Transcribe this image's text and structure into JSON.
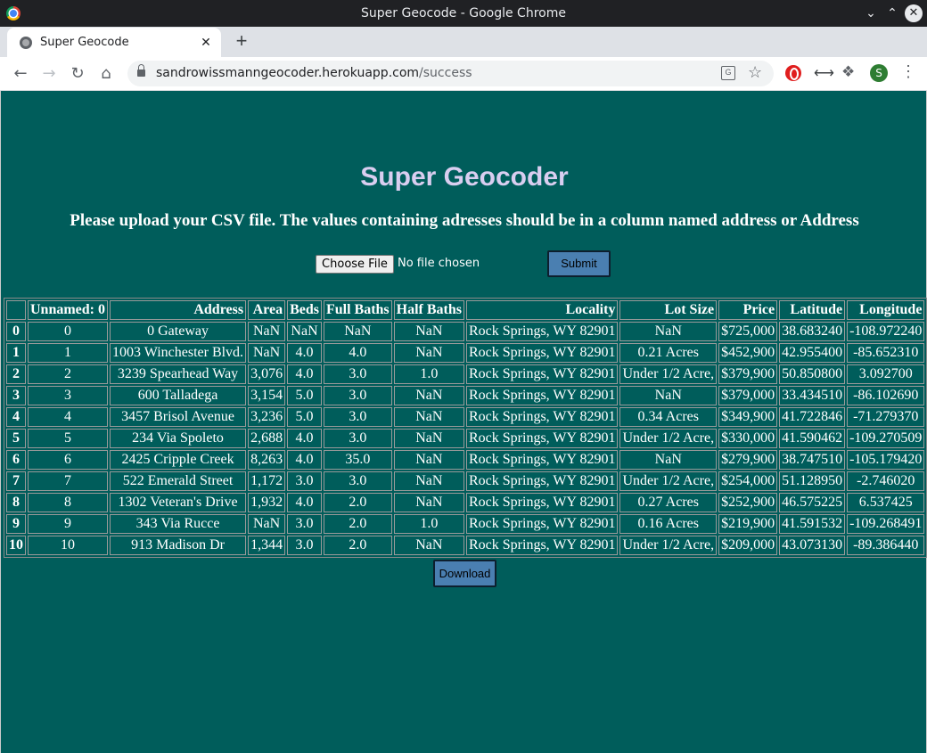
{
  "window": {
    "title": "Super Geocode - Google Chrome"
  },
  "tab": {
    "title": "Super Geocode"
  },
  "address_bar": {
    "host": "sandrowissmanngeocoder.herokuapp.com",
    "path": "/success"
  },
  "profile": {
    "initial": "S"
  },
  "page": {
    "heading": "Super Geocoder",
    "subheading": "Please upload your CSV file. The values containing adresses should be in a column named address or Address",
    "choose_file_label": "Choose File",
    "no_file_text": "No file chosen",
    "submit_label": "Submit",
    "download_label": "Download"
  },
  "table": {
    "columns": [
      "",
      "Unnamed: 0",
      "Address",
      "Area",
      "Beds",
      "Full Baths",
      "Half Baths",
      "Locality",
      "Lot Size",
      "Price",
      "Latitude",
      "Longitude"
    ],
    "rows": [
      [
        "0",
        "0",
        "0 Gateway",
        "NaN",
        "NaN",
        "NaN",
        "NaN",
        "Rock Springs, WY 82901",
        "NaN",
        "$725,000",
        "38.683240",
        "-108.972240"
      ],
      [
        "1",
        "1",
        "1003 Winchester Blvd.",
        "NaN",
        "4.0",
        "4.0",
        "NaN",
        "Rock Springs, WY 82901",
        "0.21 Acres",
        "$452,900",
        "42.955400",
        "-85.652310"
      ],
      [
        "2",
        "2",
        "3239 Spearhead Way",
        "3,076",
        "4.0",
        "3.0",
        "1.0",
        "Rock Springs, WY 82901",
        "Under 1/2 Acre,",
        "$379,900",
        "50.850800",
        "3.092700"
      ],
      [
        "3",
        "3",
        "600 Talladega",
        "3,154",
        "5.0",
        "3.0",
        "NaN",
        "Rock Springs, WY 82901",
        "NaN",
        "$379,000",
        "33.434510",
        "-86.102690"
      ],
      [
        "4",
        "4",
        "3457 Brisol Avenue",
        "3,236",
        "5.0",
        "3.0",
        "NaN",
        "Rock Springs, WY 82901",
        "0.34 Acres",
        "$349,900",
        "41.722846",
        "-71.279370"
      ],
      [
        "5",
        "5",
        "234 Via Spoleto",
        "2,688",
        "4.0",
        "3.0",
        "NaN",
        "Rock Springs, WY 82901",
        "Under 1/2 Acre,",
        "$330,000",
        "41.590462",
        "-109.270509"
      ],
      [
        "6",
        "6",
        "2425 Cripple Creek",
        "8,263",
        "4.0",
        "35.0",
        "NaN",
        "Rock Springs, WY 82901",
        "NaN",
        "$279,900",
        "38.747510",
        "-105.179420"
      ],
      [
        "7",
        "7",
        "522 Emerald Street",
        "1,172",
        "3.0",
        "3.0",
        "NaN",
        "Rock Springs, WY 82901",
        "Under 1/2 Acre,",
        "$254,000",
        "51.128950",
        "-2.746020"
      ],
      [
        "8",
        "8",
        "1302 Veteran's Drive",
        "1,932",
        "4.0",
        "2.0",
        "NaN",
        "Rock Springs, WY 82901",
        "0.27 Acres",
        "$252,900",
        "46.575225",
        "6.537425"
      ],
      [
        "9",
        "9",
        "343 Via Rucce",
        "NaN",
        "3.0",
        "2.0",
        "1.0",
        "Rock Springs, WY 82901",
        "0.16 Acres",
        "$219,900",
        "41.591532",
        "-109.268491"
      ],
      [
        "10",
        "10",
        "913 Madison Dr",
        "1,344",
        "3.0",
        "2.0",
        "NaN",
        "Rock Springs, WY 82901",
        "Under 1/2 Acre,",
        "$209,000",
        "43.073130",
        "-89.386440"
      ]
    ]
  },
  "colors": {
    "background": "#005d5b",
    "heading": "#d9cef0",
    "button": "#4a7fb1"
  }
}
